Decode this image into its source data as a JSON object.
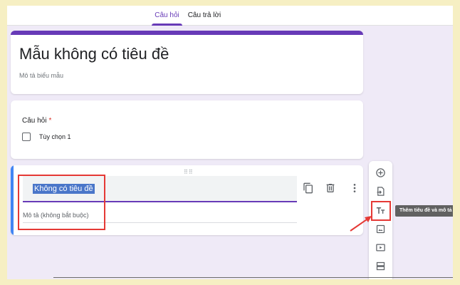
{
  "tabs": [
    {
      "label": "Câu hỏi",
      "active": true
    },
    {
      "label": "Câu trả lời",
      "active": false
    }
  ],
  "form": {
    "title": "Mẫu không có tiêu đề",
    "description_placeholder": "Mô tả biểu mẫu"
  },
  "question": {
    "label": "Câu hỏi",
    "required_mark": "*",
    "option": "Tùy chọn 1"
  },
  "section": {
    "title_value": "Không có tiêu đề",
    "description_placeholder": "Mô tả (không bắt buộc)",
    "actions": [
      "copy-icon",
      "trash-icon",
      "more-vert-icon"
    ]
  },
  "toolbar": {
    "tools": [
      "add-question-icon",
      "import-questions-icon",
      "add-title-icon",
      "add-image-icon",
      "add-video-icon",
      "add-section-icon"
    ],
    "tooltip": "Thêm tiêu đề và mô tả"
  },
  "colors": {
    "accent": "#673ab7",
    "highlight": "#e53935",
    "selection": "#4a76c9",
    "section_bar": "#4285f4"
  }
}
